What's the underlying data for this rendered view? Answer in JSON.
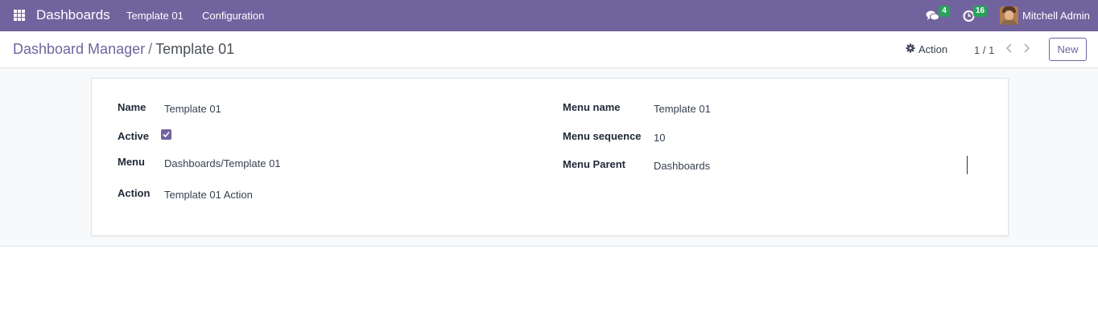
{
  "navbar": {
    "app_title": "Dashboards",
    "menu_items": [
      "Template 01",
      "Configuration"
    ],
    "messages_badge": "4",
    "activities_badge": "16",
    "user_name": "Mitchell Admin"
  },
  "control_panel": {
    "breadcrumb_parent": "Dashboard Manager",
    "breadcrumb_separator": "/",
    "breadcrumb_current": "Template 01",
    "action_label": "Action",
    "pager_value": "1 / 1",
    "new_label": "New"
  },
  "form": {
    "left": {
      "name_label": "Name",
      "name_value": "Template 01",
      "active_label": "Active",
      "active_checked": true,
      "menu_label": "Menu",
      "menu_value": "Dashboards/Template 01",
      "action_label": "Action",
      "action_value": "Template 01 Action"
    },
    "right": {
      "menu_name_label": "Menu name",
      "menu_name_value": "Template 01",
      "menu_sequence_label": "Menu sequence",
      "menu_sequence_value": "10",
      "menu_parent_label": "Menu Parent",
      "menu_parent_value": "Dashboards"
    }
  },
  "colors": {
    "brand": "#71639e",
    "badge": "#27a35a"
  },
  "icons": {
    "apps": "apps-grid-icon",
    "messages": "chat-icon",
    "activities": "clock-icon",
    "action": "gear-icon",
    "prev": "chevron-left-icon",
    "next": "chevron-right-icon"
  }
}
